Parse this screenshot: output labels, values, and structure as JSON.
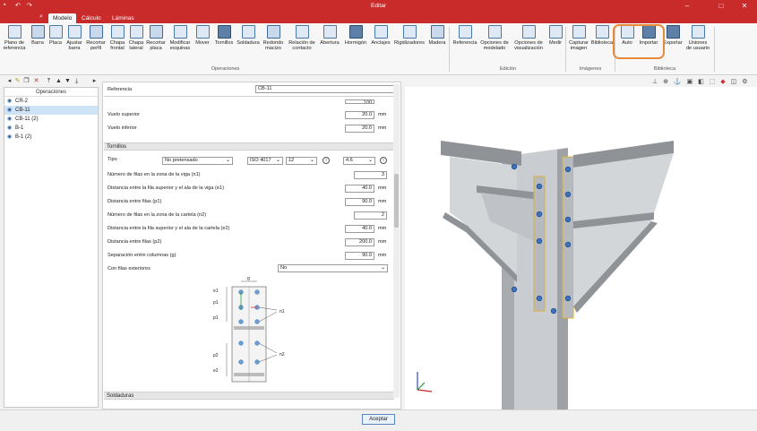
{
  "window": {
    "title": "Editar",
    "minimize": "–",
    "maximize": "□",
    "close": "✕"
  },
  "quick_access": {
    "save": "💾",
    "undo": "↶",
    "redo": "↷",
    "search": "🔍"
  },
  "tabs": [
    "Modelo",
    "Cálculo",
    "Láminas"
  ],
  "ribbon": {
    "buttons": [
      {
        "label": "Plano de\nreferencia"
      },
      {
        "label": "Barra"
      },
      {
        "label": "Placa"
      },
      {
        "label": "Ajustar\nbarra"
      },
      {
        "label": "Recortar\nperfil"
      },
      {
        "label": "Chapa\nfrontal"
      },
      {
        "label": "Chapa\nlateral"
      },
      {
        "label": "Recortar\nplaca"
      },
      {
        "label": "Modificar\nesquinas"
      },
      {
        "label": "Mover"
      },
      {
        "label": "Tornillos"
      },
      {
        "label": "Soldadura"
      },
      {
        "label": "Redondo\nmacizo"
      },
      {
        "label": "Relación de\ncontacto"
      },
      {
        "label": "Abertura"
      },
      {
        "label": "Hormigón"
      },
      {
        "label": "Anclajes"
      },
      {
        "label": "Rigidizadores"
      },
      {
        "label": "Madera"
      },
      {
        "label": "Referencia"
      },
      {
        "label": "Opciones de\nmodelado"
      },
      {
        "label": "Opciones de\nvisualización"
      },
      {
        "label": "Medir"
      },
      {
        "label": "Capturar\nimagen"
      },
      {
        "label": "Biblioteca"
      },
      {
        "label": "Auto"
      },
      {
        "label": "Importar"
      },
      {
        "label": "Exportar"
      },
      {
        "label": "Uniones\nde usuario"
      }
    ],
    "groups": [
      "Operaciones",
      "Edición",
      "Imágenes",
      "Biblioteca"
    ]
  },
  "tree": {
    "header": "Operaciones",
    "items": [
      {
        "label": "CR-2",
        "selected": false
      },
      {
        "label": "CB-11",
        "selected": true
      },
      {
        "label": "CB-11 (2)",
        "selected": false
      },
      {
        "label": "B-1",
        "selected": false
      },
      {
        "label": "B-1 (2)",
        "selected": false
      }
    ]
  },
  "form": {
    "referencia_label": "Referencia",
    "referencia_value": "CB-11",
    "top_value_partial": "100",
    "vuelo_superior_label": "Vuelo superior",
    "vuelo_superior_value": "20.0",
    "vuelo_inferior_label": "Vuelo inferior",
    "vuelo_inferior_value": "20.0",
    "unit_mm": "mm",
    "section_tornillos": "Tornillos",
    "tipo_label": "Tipo",
    "tipo_value": "No pretensado",
    "norma_value": "ISO 4017",
    "diametro_value": "12",
    "clase_value": "4.6",
    "n1_label": "Número de filas en la zona de la viga (n1)",
    "n1_value": "3",
    "e1_label": "Distancia entre la fila superior y el ala de la viga (e1)",
    "e1_value": "40.0",
    "p1_label": "Distancia entre filas (p1)",
    "p1_value": "90.0",
    "n2_label": "Número de filas en la zona de la cartela (n2)",
    "n2_value": "2",
    "e2_label": "Distancia entre la fila superior y el ala de la cartela (e2)",
    "e2_value": "40.0",
    "p2_label": "Distancia entre filas (p2)",
    "p2_value": "200.0",
    "g_label": "Separación entre columnas (g)",
    "g_value": "90.0",
    "exteriores_label": "Con filas exteriores",
    "exteriores_value": "No",
    "section_soldaduras": "Soldaduras",
    "diagram_labels": {
      "g": "g",
      "e1": "e1",
      "p1a": "p1",
      "p1b": "p1",
      "n1": "n1",
      "p2": "p2",
      "n2": "n2",
      "e2": "e2"
    }
  },
  "footer": {
    "accept": "Aceptar"
  },
  "colors": {
    "title_bar": "#c92a2a",
    "highlight": "#e98a3a",
    "selection": "#cfe3f7"
  }
}
